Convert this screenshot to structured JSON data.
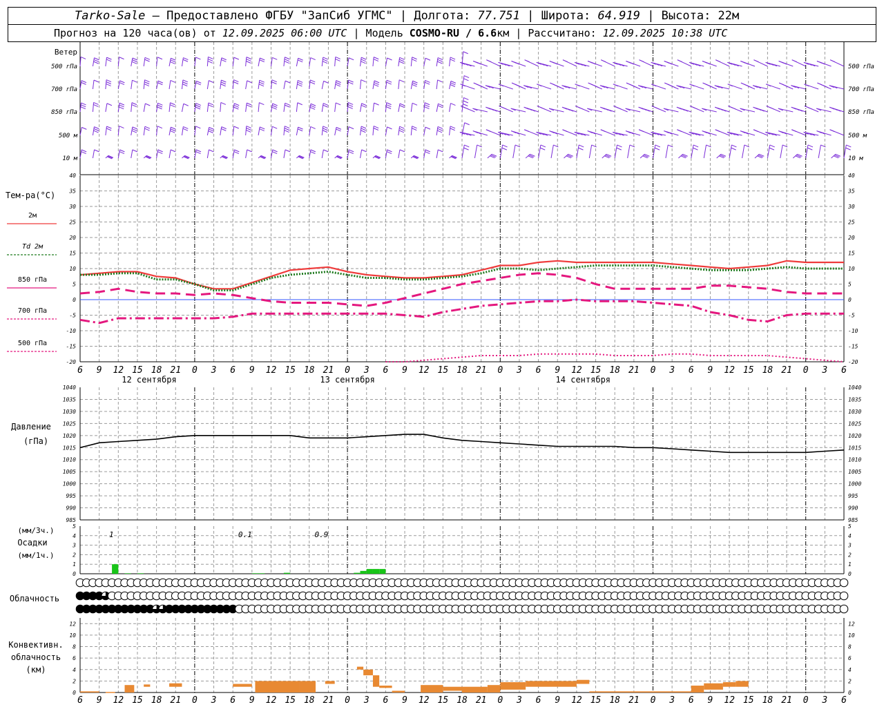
{
  "header": {
    "station": "Tarko-Sale",
    "provider": "– Предоставлено ФГБУ \"ЗапСиб УГМС\" |",
    "lon_label": "Долгота:",
    "lon_value": "77.751",
    "lat_label": "| Широта:",
    "lat_value": "64.919",
    "alt_label": "| Высота: 22м",
    "fc_label": "Прогноз на 120 часа(ов) от",
    "fc_time": "12.09.2025 06:00 UTC",
    "model_label": "| Модель",
    "model_name": "COSMO-RU / 6.6",
    "model_unit": "км",
    "calc_label": "| Рассчитано:",
    "calc_time": "12.09.2025 10:38 UTC"
  },
  "colors": {
    "wind": "#7a2bd8",
    "t2m": "#ef3b3b",
    "td2m": "#1e7a1e",
    "t850": "#e4177e",
    "t700": "#e4177e",
    "t500": "#e4177e",
    "zero": "#3355ff",
    "pressure": "#000000",
    "precip": "#18c418",
    "convective": "#e88932"
  },
  "chart_data": [
    {
      "type": "line",
      "name": "wind",
      "title": "Ветер",
      "level_labels": [
        "500 гПа",
        "700 гПа",
        "850 гПа",
        "500 м",
        "10 м"
      ]
    },
    {
      "type": "line",
      "name": "temperature",
      "title": "Тем-ра(°C)",
      "ylim": [
        -20,
        40
      ],
      "yticks": [
        -20,
        -15,
        -10,
        -5,
        0,
        5,
        10,
        15,
        20,
        25,
        30,
        35,
        40
      ],
      "x_hours": [
        0,
        3,
        6,
        9,
        12,
        15,
        18,
        21,
        24,
        27,
        30,
        33,
        36,
        39,
        42,
        45,
        48,
        51,
        54,
        57,
        60,
        63,
        66,
        69,
        72,
        75,
        78,
        81,
        84,
        87,
        90,
        93,
        96,
        99,
        102,
        105,
        108,
        111,
        114,
        117,
        120
      ],
      "x_tick_labels": [
        "6",
        "9",
        "12",
        "15",
        "18",
        "21",
        "0",
        "3",
        "6",
        "9",
        "12",
        "15",
        "18",
        "21",
        "0",
        "3",
        "6",
        "9",
        "12",
        "15",
        "18",
        "21",
        "0",
        "3",
        "6",
        "9",
        "12"
      ],
      "date_labels": [
        "12 сентября",
        "13 сентября",
        "14 сентября"
      ],
      "series": [
        {
          "name": "2м",
          "style": "solid",
          "values": [
            8,
            8.5,
            9,
            9,
            7.5,
            7,
            5,
            3.5,
            3.5,
            5.5,
            7.5,
            9.5,
            10,
            10.5,
            9,
            8,
            7.5,
            7,
            7,
            7.5,
            8,
            9.5,
            11,
            11,
            12,
            12.5,
            12,
            12,
            12,
            12,
            12,
            11.5,
            11,
            10.5,
            10,
            10.5,
            11,
            12.5,
            12,
            12,
            12
          ]
        },
        {
          "name": "Td 2м",
          "style": "dotted",
          "values": [
            8,
            8,
            8.5,
            8.5,
            6.5,
            6.5,
            5,
            3,
            3,
            5,
            7,
            8,
            8.5,
            9,
            8,
            7,
            7,
            6.5,
            6.5,
            7,
            7.5,
            8.5,
            10,
            10,
            9.5,
            10,
            10.5,
            11,
            11,
            11,
            11,
            10.5,
            10,
            9.5,
            9.5,
            9.5,
            10,
            10.5,
            10,
            10,
            10
          ]
        },
        {
          "name": "850 гПа",
          "style": "dashed",
          "values": [
            2,
            2.5,
            3.5,
            2.5,
            2,
            2,
            1.5,
            2,
            1.5,
            0.5,
            -0.5,
            -1,
            -1,
            -1,
            -1.5,
            -2,
            -1,
            0.5,
            2,
            3.5,
            5,
            6,
            7,
            8,
            8.5,
            8,
            7,
            5,
            3.5,
            3.5,
            3.5,
            3.5,
            3.5,
            4.5,
            4.5,
            4,
            3.5,
            2.5,
            2,
            2,
            2
          ]
        },
        {
          "name": "700 гПа",
          "style": "dashdot",
          "values": [
            -6.5,
            -7.5,
            -6,
            -6,
            -6,
            -6,
            -6,
            -6,
            -5.5,
            -4.5,
            -4.5,
            -4.5,
            -4.5,
            -4.5,
            -4.5,
            -4.5,
            -4.5,
            -5,
            -5.5,
            -4,
            -3,
            -2,
            -1.5,
            -1,
            -0.5,
            -0.5,
            0,
            -0.5,
            -0.5,
            -0.5,
            -1,
            -1.5,
            -2,
            -4,
            -5,
            -6.5,
            -7,
            -5,
            -4.5,
            -4.5,
            -4.5
          ]
        },
        {
          "name": "500 гПа",
          "style": "dotted",
          "values": [
            null,
            null,
            null,
            null,
            null,
            null,
            null,
            null,
            null,
            null,
            null,
            null,
            null,
            null,
            null,
            null,
            -20,
            -20,
            -19.5,
            -19,
            -18.5,
            -18,
            -18,
            -18,
            -17.5,
            -17.5,
            -17.5,
            -17.5,
            -18,
            -18,
            -18,
            -17.5,
            -17.5,
            -18,
            -18,
            -18,
            -18,
            -18.5,
            -19,
            -19.5,
            -20
          ]
        }
      ]
    },
    {
      "type": "line",
      "name": "pressure",
      "title": "Давление",
      "ylabel": "(гПа)",
      "ylim": [
        985,
        1040
      ],
      "yticks": [
        985,
        990,
        995,
        1000,
        1005,
        1010,
        1015,
        1020,
        1025,
        1030,
        1035,
        1040
      ],
      "series": [
        {
          "name": "Давление",
          "values": [
            1015,
            1017,
            1017.5,
            1018,
            1018.5,
            1019.5,
            1020,
            1020,
            1020,
            1020,
            1020,
            1020,
            1019,
            1019,
            1019,
            1019.5,
            1020,
            1020.5,
            1020.5,
            1019,
            1018,
            1017.5,
            1017,
            1016.5,
            1016,
            1015.5,
            1015.5,
            1015.5,
            1015.5,
            1015,
            1015,
            1014.5,
            1014,
            1013.5,
            1013,
            1013,
            1013,
            1013,
            1013,
            1013.5,
            1014
          ]
        }
      ]
    },
    {
      "type": "bar",
      "name": "precipitation",
      "title": "Осадки",
      "ylabel_top": "(мм/3ч.)",
      "ylabel_bottom": "(мм/1ч.)",
      "ylim": [
        0,
        5
      ],
      "yticks": [
        0,
        1,
        2,
        3,
        4,
        5
      ],
      "sum_labels": [
        {
          "hour": 6,
          "text": "1"
        },
        {
          "hour": 27,
          "text": "0.1"
        },
        {
          "hour": 39,
          "text": "0.9"
        }
      ],
      "bars": [
        {
          "hour": 5.5,
          "value": 1.0
        },
        {
          "hour": 7.5,
          "value": 0.05
        },
        {
          "hour": 9.5,
          "value": 0.05
        },
        {
          "hour": 27.5,
          "value": 0.05
        },
        {
          "hour": 28.5,
          "value": 0.05
        },
        {
          "hour": 32.5,
          "value": 0.1
        },
        {
          "hour": 43.5,
          "value": 0.1
        },
        {
          "hour": 44.5,
          "value": 0.3
        },
        {
          "hour": 45.5,
          "value": 0.5
        },
        {
          "hour": 46.5,
          "value": 0.5
        },
        {
          "hour": 47.5,
          "value": 0.5
        }
      ]
    },
    {
      "type": "table",
      "name": "cloudiness",
      "title": "Облачность",
      "scale": "oktas 0–8 per hour",
      "rows": [
        {
          "name": "upper",
          "values": [
            0,
            0,
            0,
            0,
            0,
            0,
            0,
            0,
            0,
            0,
            0,
            0,
            0,
            0,
            0,
            0,
            0,
            0,
            0,
            0,
            0,
            0,
            0,
            0,
            0,
            0,
            0,
            0,
            0,
            0,
            0,
            0,
            0,
            0,
            0,
            0,
            0,
            0,
            0,
            0,
            0,
            0,
            0,
            0,
            0,
            0,
            0,
            0,
            0,
            0,
            0,
            0,
            0,
            0,
            0,
            0,
            0,
            0,
            0,
            0,
            0,
            0,
            0,
            0,
            0,
            0,
            0,
            0,
            0,
            0,
            0,
            0,
            0,
            0,
            0,
            0,
            0,
            0,
            0,
            0,
            0,
            0,
            0,
            0,
            0,
            0,
            0,
            0,
            0,
            0,
            0,
            0,
            0,
            0,
            0,
            0,
            0,
            0,
            0,
            0,
            0,
            0,
            0,
            0,
            0,
            0,
            0,
            0,
            0,
            0,
            0,
            0,
            0,
            0,
            0,
            0,
            0,
            0,
            0,
            0,
            0
          ]
        },
        {
          "name": "middle",
          "values": [
            8,
            8,
            8,
            8,
            6,
            0,
            0,
            0,
            0,
            0,
            0,
            0,
            0,
            0,
            0,
            0,
            0,
            0,
            0,
            0,
            0,
            0,
            0,
            0,
            0,
            0,
            0,
            0,
            0,
            0,
            0,
            0,
            0,
            0,
            0,
            0,
            0,
            0,
            0,
            0,
            0,
            0,
            0,
            0,
            0,
            0,
            0,
            0,
            0,
            0,
            0,
            0,
            0,
            0,
            0,
            0,
            0,
            0,
            0,
            0,
            0,
            0,
            0,
            0,
            0,
            0,
            0,
            0,
            0,
            0,
            0,
            0,
            0,
            0,
            0,
            0,
            0,
            0,
            0,
            0,
            0,
            0,
            0,
            0,
            0,
            0,
            0,
            0,
            0,
            0,
            0,
            0,
            0,
            0,
            0,
            0,
            0,
            0,
            0,
            0,
            0,
            0,
            0,
            0,
            0,
            0,
            0,
            0,
            0,
            0,
            0,
            0,
            0,
            0,
            0,
            0,
            0,
            0,
            0,
            0,
            0
          ]
        },
        {
          "name": "lower",
          "values": [
            8,
            8,
            8,
            8,
            8,
            8,
            8,
            8,
            8,
            8,
            8,
            8,
            6,
            6,
            8,
            8,
            8,
            8,
            8,
            8,
            8,
            8,
            8,
            8,
            8,
            0,
            0,
            0,
            0,
            0,
            0,
            0,
            0,
            0,
            0,
            0,
            0,
            0,
            0,
            0,
            0,
            0,
            0,
            0,
            0,
            0,
            0,
            0,
            0,
            0,
            0,
            0,
            0,
            0,
            0,
            0,
            0,
            0,
            0,
            0,
            0,
            0,
            0,
            0,
            0,
            0,
            0,
            0,
            0,
            0,
            0,
            0,
            0,
            0,
            0,
            0,
            0,
            0,
            0,
            0,
            0,
            0,
            0,
            0,
            0,
            0,
            0,
            0,
            0,
            0,
            0,
            0,
            0,
            0,
            0,
            0,
            0,
            0,
            0,
            0,
            0,
            0,
            0,
            0,
            0,
            0,
            0,
            0,
            0,
            0,
            0,
            0,
            0,
            0,
            0,
            0,
            0,
            0,
            0,
            0,
            0
          ]
        }
      ]
    },
    {
      "type": "bar",
      "name": "convective",
      "title_lines": [
        "Конвективн.",
        "облачность",
        "(км)"
      ],
      "ylim": [
        0,
        13
      ],
      "yticks": [
        0,
        2,
        4,
        6,
        8,
        10,
        12
      ],
      "segments": [
        {
          "from": 0,
          "to": 3,
          "bottom": 0,
          "top": 0.2
        },
        {
          "from": 4,
          "to": 5.5,
          "bottom": 0,
          "top": 0.1
        },
        {
          "from": 7,
          "to": 8.5,
          "bottom": 0,
          "top": 1.3
        },
        {
          "from": 10,
          "to": 11,
          "bottom": 1,
          "top": 1.4
        },
        {
          "from": 14,
          "to": 16,
          "bottom": 1,
          "top": 1.6
        },
        {
          "from": 24,
          "to": 27,
          "bottom": 1,
          "top": 1.5
        },
        {
          "from": 27.5,
          "to": 34.5,
          "bottom": 0,
          "top": 2
        },
        {
          "from": 34.5,
          "to": 37,
          "bottom": 0,
          "top": 2
        },
        {
          "from": 38.5,
          "to": 40,
          "bottom": 1.5,
          "top": 2
        },
        {
          "from": 43.5,
          "to": 44.5,
          "bottom": 4,
          "top": 4.5
        },
        {
          "from": 44.5,
          "to": 46,
          "bottom": 3,
          "top": 4
        },
        {
          "from": 46,
          "to": 47,
          "bottom": 1,
          "top": 3
        },
        {
          "from": 47,
          "to": 49,
          "bottom": 0.8,
          "top": 1.2
        },
        {
          "from": 49,
          "to": 51,
          "bottom": 0,
          "top": 0.3
        },
        {
          "from": 53.5,
          "to": 57,
          "bottom": 0,
          "top": 1.3
        },
        {
          "from": 57,
          "to": 60,
          "bottom": 0.3,
          "top": 1
        },
        {
          "from": 60,
          "to": 64,
          "bottom": 0,
          "top": 1
        },
        {
          "from": 64,
          "to": 66,
          "bottom": 0,
          "top": 1.3
        },
        {
          "from": 66,
          "to": 70,
          "bottom": 0.5,
          "top": 1.8
        },
        {
          "from": 70,
          "to": 78,
          "bottom": 1,
          "top": 2
        },
        {
          "from": 78,
          "to": 80,
          "bottom": 1.5,
          "top": 2.2
        },
        {
          "from": 80,
          "to": 96,
          "bottom": 0,
          "top": 0.2
        },
        {
          "from": 96,
          "to": 98,
          "bottom": 0,
          "top": 1.2
        },
        {
          "from": 98,
          "to": 101,
          "bottom": 0.5,
          "top": 1.6
        },
        {
          "from": 101,
          "to": 103,
          "bottom": 1,
          "top": 1.8
        },
        {
          "from": 103,
          "to": 105,
          "bottom": 1,
          "top": 2
        }
      ]
    }
  ]
}
